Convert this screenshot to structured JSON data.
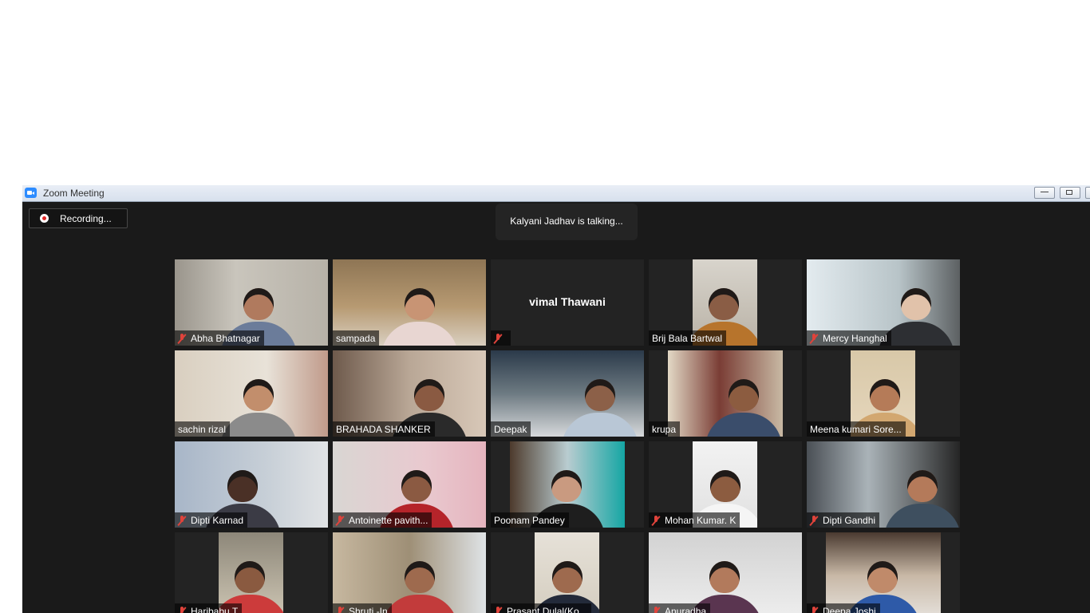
{
  "window": {
    "title": "Zoom Meeting",
    "controls": [
      "minimize",
      "restore",
      "close"
    ]
  },
  "recording": {
    "label": "Recording...",
    "icon": "record-dot-icon"
  },
  "active_speaker": {
    "text": "Kalyani Jadhav is talking..."
  },
  "participants": [
    {
      "name": "Abha Bhatnagar",
      "muted": true,
      "video": true
    },
    {
      "name": "sampada",
      "muted": false,
      "video": true
    },
    {
      "name": "vimal Thawani",
      "muted": true,
      "video": false
    },
    {
      "name": "Brij Bala Bartwal",
      "muted": false,
      "video": true
    },
    {
      "name": "Mercy Hanghal",
      "muted": true,
      "video": true
    },
    {
      "name": "sachin rizal",
      "muted": false,
      "video": true
    },
    {
      "name": "BRAHADA SHANKER",
      "muted": false,
      "video": true
    },
    {
      "name": "Deepak",
      "muted": false,
      "video": true
    },
    {
      "name": "krupa",
      "muted": false,
      "video": true
    },
    {
      "name": "Meena kumari Sore...",
      "muted": false,
      "video": true
    },
    {
      "name": "Dipti Karnad",
      "muted": true,
      "video": true
    },
    {
      "name": "Antoinette pavith...",
      "muted": true,
      "video": true
    },
    {
      "name": "Poonam Pandey",
      "muted": false,
      "video": true
    },
    {
      "name": "Mohan Kumar. K",
      "muted": true,
      "video": true
    },
    {
      "name": "Dipti Gandhi",
      "muted": true,
      "video": true
    },
    {
      "name": "Haribabu T",
      "muted": true,
      "video": true
    },
    {
      "name": "Shruti -In",
      "muted": true,
      "video": true
    },
    {
      "name": "Prasant Dulal(Ko...",
      "muted": true,
      "video": true
    },
    {
      "name": "Anuradha",
      "muted": true,
      "video": true
    },
    {
      "name": "Deepa Joshi",
      "muted": true,
      "video": true
    }
  ]
}
